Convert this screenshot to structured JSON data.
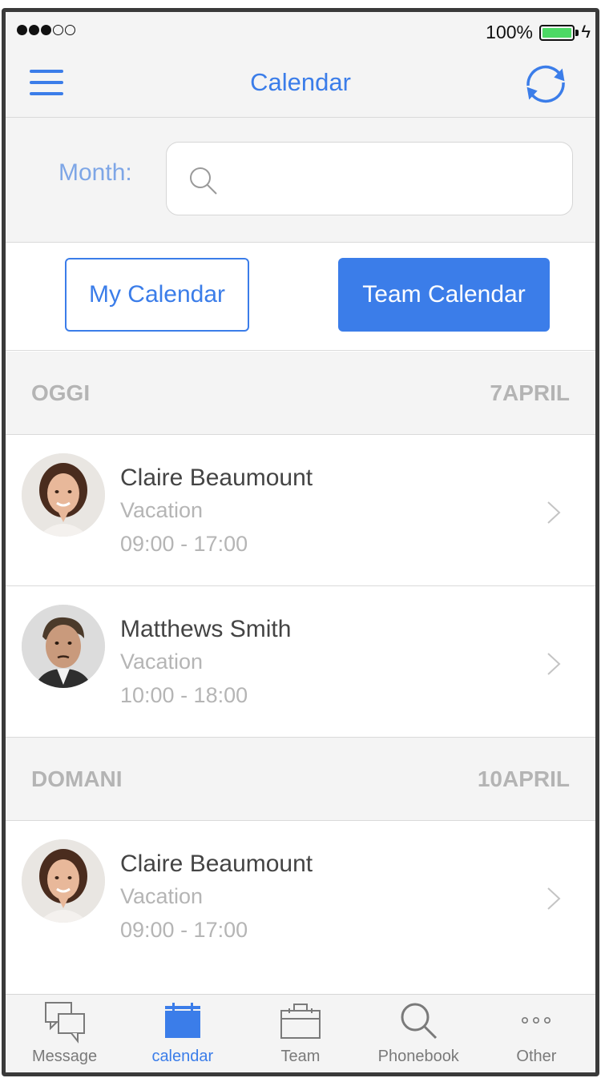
{
  "status_bar": {
    "signal": [
      "full",
      "full",
      "full",
      "empty",
      "empty"
    ],
    "battery_percent": "100%"
  },
  "nav": {
    "title": "Calendar"
  },
  "search": {
    "month_label": "Month:",
    "value": "",
    "placeholder": ""
  },
  "segments": {
    "my_calendar": "My Calendar",
    "team_calendar": "Team Calendar",
    "selected": "Team Calendar"
  },
  "sections": [
    {
      "day": "OGGI",
      "date": "7APRIL",
      "events": [
        {
          "name": "Claire Beaumount",
          "type": "Vacation",
          "time": "09:00 - 17:00",
          "avatar": "woman"
        },
        {
          "name": "Matthews Smith",
          "type": "Vacation",
          "time": "10:00 - 18:00",
          "avatar": "man"
        }
      ]
    },
    {
      "day": "DOMANI",
      "date": "10APRIL",
      "events": [
        {
          "name": "Claire Beaumount",
          "type": "Vacation",
          "time": "09:00 - 17:00",
          "avatar": "woman"
        }
      ]
    }
  ],
  "tabs": [
    {
      "label": "Message",
      "icon": "message-icon",
      "active": false
    },
    {
      "label": "calendar",
      "icon": "calendar-icon",
      "active": true
    },
    {
      "label": "Team",
      "icon": "briefcase-icon",
      "active": false
    },
    {
      "label": "Phonebook",
      "icon": "search-icon",
      "active": false
    },
    {
      "label": "Other",
      "icon": "more-icon",
      "active": false
    }
  ],
  "colors": {
    "accent": "#3b7de9",
    "muted": "#b5b5b5",
    "background": "#f4f4f4",
    "battery": "#4cd964"
  }
}
